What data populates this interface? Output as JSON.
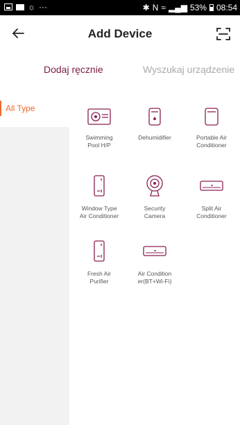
{
  "status_bar": {
    "notification_icons": [
      "image-icon",
      "mail-icon",
      "weather-icon",
      "more-icon"
    ],
    "battery": "53%",
    "time": "08:54"
  },
  "header": {
    "title": "Add Device"
  },
  "tabs": [
    {
      "label": "Dodaj ręcznie",
      "active": true
    },
    {
      "label": "Wyszukaj urządzenie",
      "active": false
    }
  ],
  "sidebar": {
    "items": [
      {
        "label": "All Type",
        "selected": true
      }
    ]
  },
  "devices": [
    {
      "label": "Swimming\nPool H/P",
      "icon": "pool-heat-pump-icon"
    },
    {
      "label": "Dehumidifier",
      "icon": "dehumidifier-icon"
    },
    {
      "label": "Portable Air\nConditioner",
      "icon": "portable-ac-icon"
    },
    {
      "label": "Window Type\nAir Conditioner",
      "icon": "window-ac-icon"
    },
    {
      "label": "Security\nCamera",
      "icon": "security-camera-icon"
    },
    {
      "label": "Split Air\nConditioner",
      "icon": "split-ac-icon"
    },
    {
      "label": "Fresh Air\nPurifier",
      "icon": "air-purifier-icon"
    },
    {
      "label": "Air Condition\ner(BT+Wi-Fi)",
      "icon": "split-ac-bt-icon"
    }
  ],
  "colors": {
    "accent": "#7a1b44",
    "sidebar_active": "#ee6a2f",
    "icon_stroke": "#8a1d52"
  }
}
